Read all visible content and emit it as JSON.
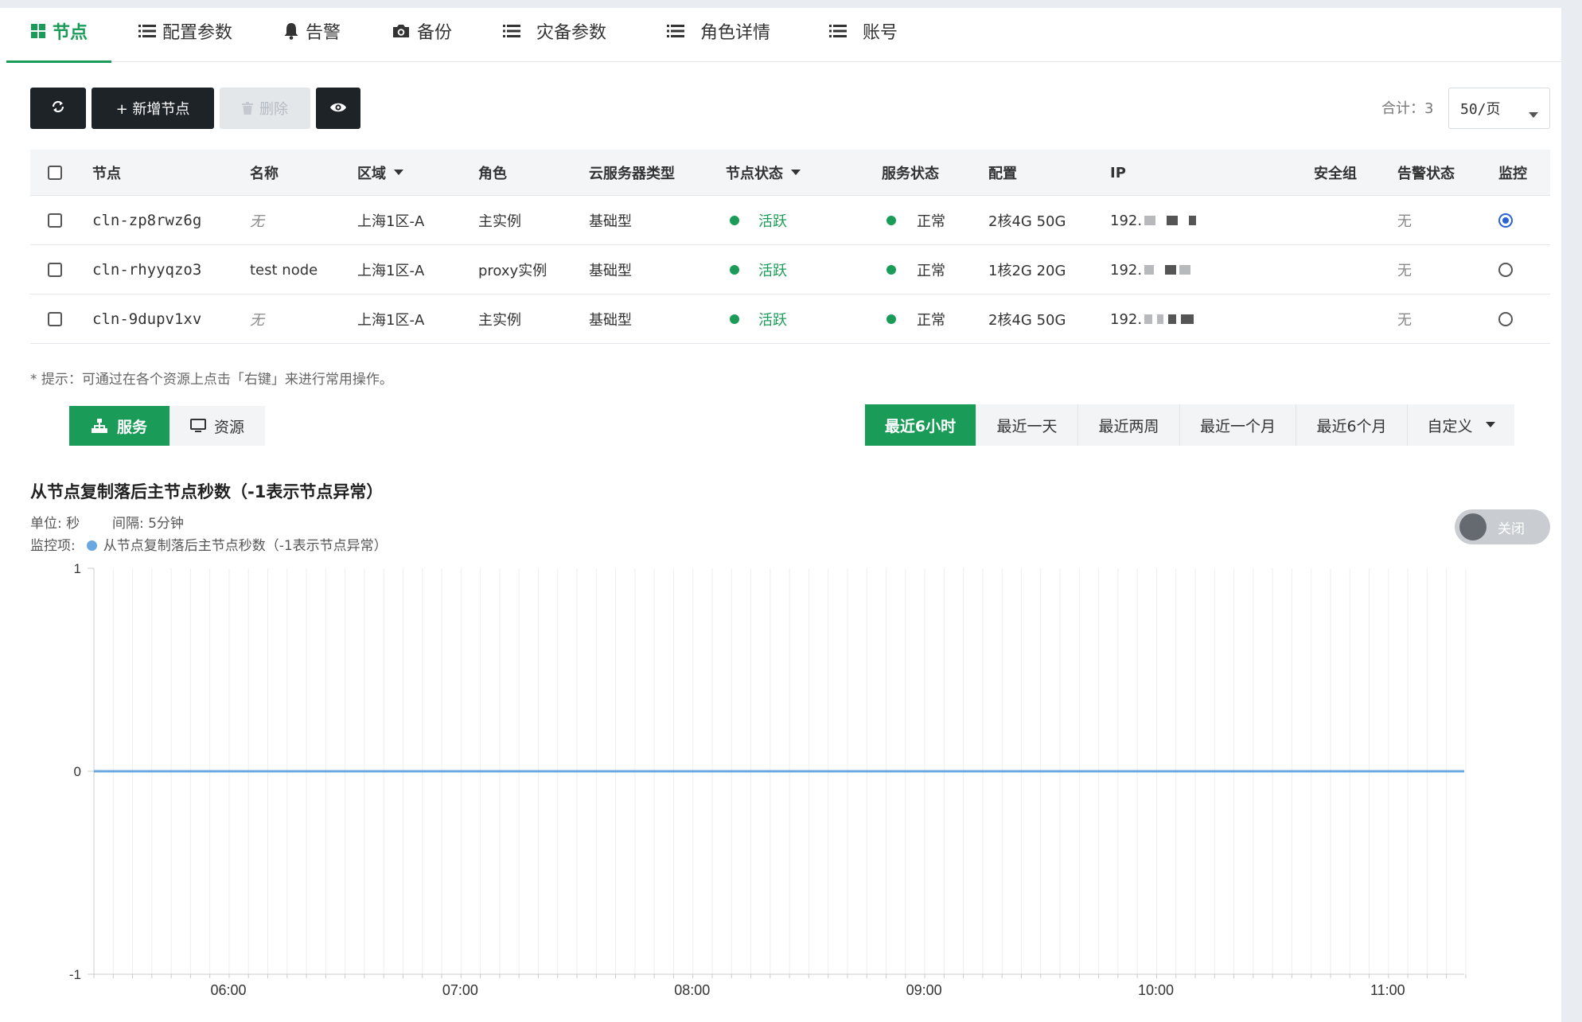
{
  "tabs": [
    {
      "label": "节点",
      "icon": "grid-icon",
      "active": true
    },
    {
      "label": "配置参数",
      "icon": "list-icon"
    },
    {
      "label": "告警",
      "icon": "bell-icon"
    },
    {
      "label": "备份",
      "icon": "camera-icon"
    },
    {
      "label": "灾备参数",
      "icon": "list-icon"
    },
    {
      "label": "角色详情",
      "icon": "list-icon"
    },
    {
      "label": "账号",
      "icon": "list-icon"
    }
  ],
  "toolbar": {
    "add_label": "+ 新增节点",
    "delete_label": "删除",
    "total_label": "合计：3",
    "page_size": "50/页"
  },
  "table": {
    "headers": {
      "node": "节点",
      "name": "名称",
      "zone": "区域",
      "role": "角色",
      "server_type": "云服务器类型",
      "node_status": "节点状态",
      "service_status": "服务状态",
      "config": "配置",
      "ip": "IP",
      "security_group": "安全组",
      "alert_status": "告警状态",
      "monitor": "监控"
    },
    "rows": [
      {
        "node": "cln-zp8rwz6g",
        "name": "无",
        "zone": "上海1区-A",
        "role": "主实例",
        "server_type": "基础型",
        "node_status": "活跃",
        "service_status": "正常",
        "config": "2核4G 50G",
        "ip": "192.",
        "alert_status": "无",
        "monitor_selected": true
      },
      {
        "node": "cln-rhyyqzo3",
        "name": "test node",
        "zone": "上海1区-A",
        "role": "proxy实例",
        "server_type": "基础型",
        "node_status": "活跃",
        "service_status": "正常",
        "config": "1核2G 20G",
        "ip": "192.",
        "alert_status": "无",
        "monitor_selected": false
      },
      {
        "node": "cln-9dupv1xv",
        "name": "无",
        "zone": "上海1区-A",
        "role": "主实例",
        "server_type": "基础型",
        "node_status": "活跃",
        "service_status": "正常",
        "config": "2核4G 50G",
        "ip": "192.",
        "alert_status": "无",
        "monitor_selected": false
      }
    ]
  },
  "hint": "* 提示：可通过在各个资源上点击「右键」来进行常用操作。",
  "view_switch": {
    "service": "服务",
    "resource": "资源"
  },
  "time_ranges": [
    "最近6小时",
    "最近一天",
    "最近两周",
    "最近一个月",
    "最近6个月",
    "自定义"
  ],
  "chart_header": {
    "title": "从节点复制落后主节点秒数（-1表示节点异常）",
    "unit": "单位: 秒",
    "interval": "间隔: 5分钟",
    "monitor_label": "监控项:",
    "series_legend": "从节点复制落后主节点秒数（-1表示节点异常）",
    "toggle_label": "关闭"
  },
  "colors": {
    "primary_green": "#1a9b58",
    "series_blue": "#6aa8e1",
    "radio_blue": "#2a62d6"
  },
  "chart_data": {
    "type": "line",
    "xlabel": "",
    "ylabel": "",
    "ylim": [
      -1,
      1
    ],
    "yticks": [
      "1",
      "0",
      "-1"
    ],
    "xticks": [
      "06:00",
      "07:00",
      "08:00",
      "09:00",
      "10:00",
      "11:00"
    ],
    "x_start_hour": 5.42,
    "x_end_hour": 11.33,
    "interval_minutes": 5,
    "series": [
      {
        "value_constant": 0
      }
    ],
    "grid": "vertical"
  }
}
